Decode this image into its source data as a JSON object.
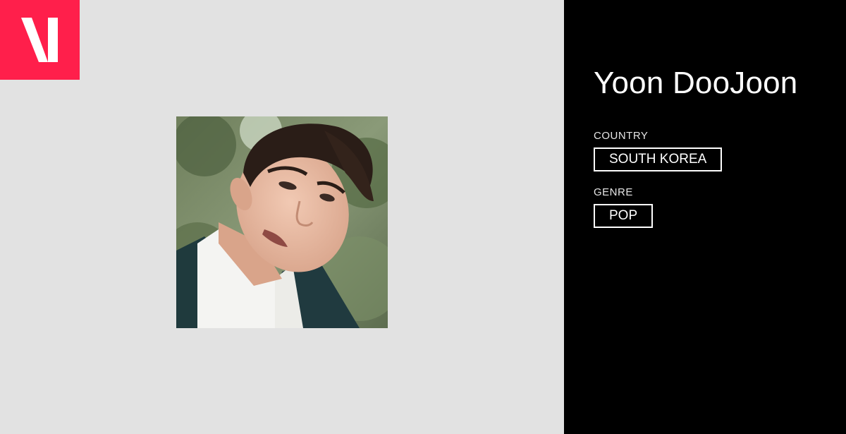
{
  "brand": {
    "logo_letter": "V",
    "logo_color": "#ff1f4b"
  },
  "artist": {
    "name": "Yoon DooJoon",
    "photo": "portrait-photo"
  },
  "details": {
    "country_label": "COUNTRY",
    "country_value": "SOUTH KOREA",
    "genre_label": "GENRE",
    "genre_value": "POP"
  },
  "colors": {
    "left_background": "#e2e2e2",
    "right_background": "#000000",
    "text": "#ffffff"
  }
}
